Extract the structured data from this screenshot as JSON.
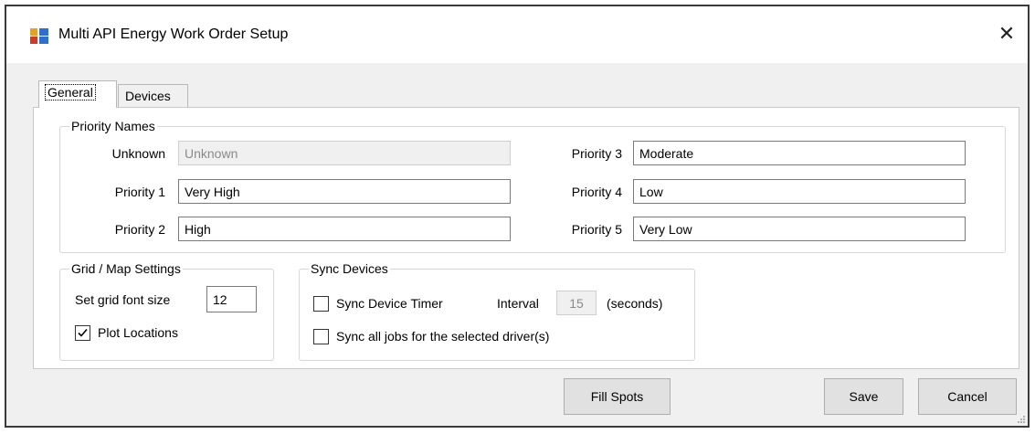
{
  "window": {
    "title": "Multi API Energy Work Order Setup",
    "close_glyph": "✕"
  },
  "tabs": [
    {
      "label": "General",
      "active": true
    },
    {
      "label": "Devices",
      "active": false
    }
  ],
  "priority_names": {
    "legend": "Priority Names",
    "unknown": {
      "label": "Unknown",
      "value": "Unknown",
      "disabled": true
    },
    "p1": {
      "label": "Priority 1",
      "value": "Very High"
    },
    "p2": {
      "label": "Priority 2",
      "value": "High"
    },
    "p3": {
      "label": "Priority 3",
      "value": "Moderate"
    },
    "p4": {
      "label": "Priority 4",
      "value": "Low"
    },
    "p5": {
      "label": "Priority 5",
      "value": "Very Low"
    }
  },
  "grid_map": {
    "legend": "Grid / Map Settings",
    "font_size_label": "Set grid font size",
    "font_size_value": "12",
    "plot_locations_label": "Plot Locations",
    "plot_locations_checked": true
  },
  "sync_devices": {
    "legend": "Sync Devices",
    "timer_label": "Sync Device Timer",
    "timer_checked": false,
    "interval_label": "Interval",
    "interval_value": "15",
    "seconds_label": "(seconds)",
    "sync_all_label": "Sync all jobs for the selected driver(s)",
    "sync_all_checked": false
  },
  "buttons": {
    "fill_spots": "Fill Spots",
    "save": "Save",
    "cancel": "Cancel"
  }
}
